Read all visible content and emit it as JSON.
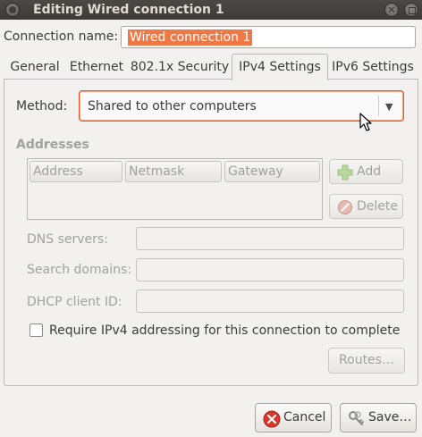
{
  "window": {
    "title": "Editing Wired connection 1"
  },
  "connection": {
    "label": "Connection name:",
    "value": "Wired connection 1"
  },
  "tabs": [
    {
      "label": "General",
      "active": false
    },
    {
      "label": "Ethernet",
      "active": false
    },
    {
      "label": "802.1x Security",
      "active": false
    },
    {
      "label": "IPv4 Settings",
      "active": true
    },
    {
      "label": "IPv6 Settings",
      "active": false
    }
  ],
  "ipv4": {
    "method_label": "Method:",
    "method_value": "Shared to other computers",
    "addresses_heading": "Addresses",
    "columns": [
      "Address",
      "Netmask",
      "Gateway"
    ],
    "add_label": "Add",
    "delete_label": "Delete",
    "dns_label": "DNS servers:",
    "dns_value": "",
    "search_label": "Search domains:",
    "search_value": "",
    "dhcp_label": "DHCP client ID:",
    "dhcp_value": "",
    "require_label": "Require IPv4 addressing for this connection to complete",
    "require_checked": false,
    "routes_label": "Routes…"
  },
  "actions": {
    "cancel_label": "Cancel",
    "save_label": "Save…"
  },
  "colors": {
    "accent": "#e05a2b",
    "selection": "#f07746",
    "titlebar": "#3c3b37"
  }
}
